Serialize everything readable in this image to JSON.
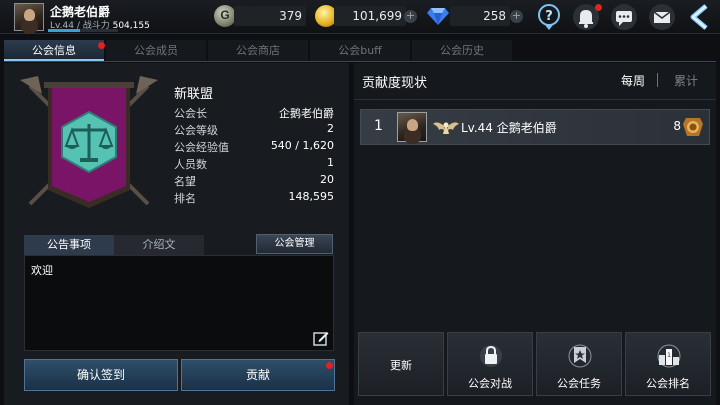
{
  "player": {
    "name": "企鹅老伯爵",
    "level_text": "Lv.44 / 战斗力",
    "power": "504,155",
    "xp_progress": 0.45
  },
  "currencies": {
    "g_coin": "379",
    "gold": "101,699",
    "gems": "258"
  },
  "tabs": [
    "公会信息",
    "公会成员",
    "公会商店",
    "公会buff",
    "公会历史"
  ],
  "guild": {
    "name": "新联盟",
    "info": [
      {
        "key": "公会长",
        "value": "企鹅老伯爵"
      },
      {
        "key": "公会等级",
        "value": "2"
      },
      {
        "key": "公会经验值",
        "value": "540 / 1,620"
      },
      {
        "key": "人员数",
        "value": "1"
      },
      {
        "key": "名望",
        "value": "20"
      },
      {
        "key": "排名",
        "value": "148,595"
      }
    ]
  },
  "notice": {
    "tabs": [
      "公告事项",
      "介绍文"
    ],
    "manage_label": "公会管理",
    "text": "欢迎"
  },
  "actions": {
    "checkin_label": "确认签到",
    "donate_label": "贡献"
  },
  "contribution": {
    "title": "贡献度现状",
    "periods": [
      "每周",
      "累计"
    ],
    "rows": [
      {
        "rank": "1",
        "name": "Lv.44 企鹅老伯爵",
        "score": "8"
      }
    ]
  },
  "bottom_buttons": {
    "refresh": "更新",
    "war": "公会对战",
    "mission": "公会任务",
    "ranking": "公会排名"
  },
  "colors": {
    "accent": "#8fc8ee",
    "alert": "#e02222",
    "banner": "#7a1466",
    "emblem": "#55c2b3"
  }
}
